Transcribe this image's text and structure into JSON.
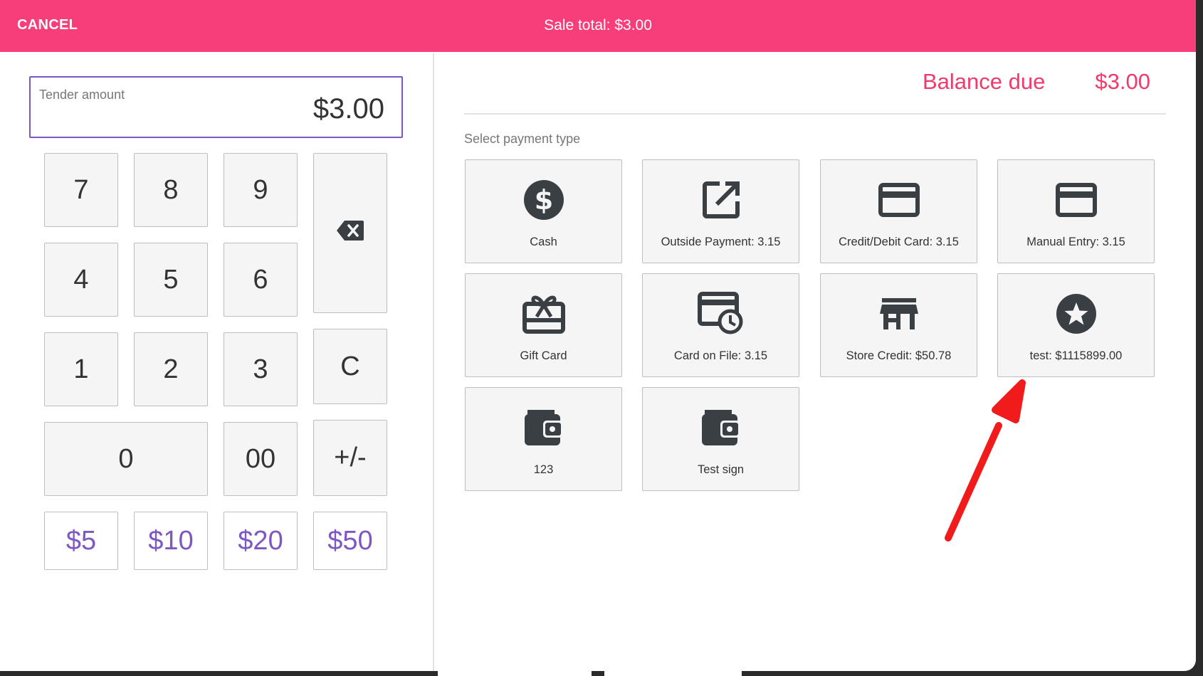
{
  "header": {
    "cancel_label": "CANCEL",
    "sale_total": "Sale total: $3.00",
    "bar_color": "#f73e7b"
  },
  "tender": {
    "label": "Tender amount",
    "value": "$3.00"
  },
  "keypad": {
    "digits": [
      "7",
      "8",
      "9",
      "4",
      "5",
      "6",
      "1",
      "2",
      "3"
    ],
    "zero": "0",
    "double_zero": "00",
    "clear": "C",
    "sign": "+/-",
    "backspace_icon": "backspace-icon",
    "quick_amounts": [
      "$5",
      "$10",
      "$20",
      "$50"
    ],
    "accent_color": "#7e57c2"
  },
  "balance": {
    "label": "Balance due",
    "value": "$3.00",
    "color": "#f03a6c"
  },
  "payment": {
    "section_label": "Select payment type",
    "types": [
      {
        "label": "Cash",
        "icon": "dollar-circle-icon"
      },
      {
        "label": "Outside Payment: 3.15",
        "icon": "external-link-icon"
      },
      {
        "label": "Credit/Debit Card: 3.15",
        "icon": "credit-card-icon"
      },
      {
        "label": "Manual Entry: 3.15",
        "icon": "credit-card-icon"
      },
      {
        "label": "Gift Card",
        "icon": "gift-card-icon"
      },
      {
        "label": "Card on File: 3.15",
        "icon": "card-clock-icon"
      },
      {
        "label": "Store Credit: $50.78",
        "icon": "store-icon"
      },
      {
        "label": "test: $1115899.00",
        "icon": "star-circle-icon"
      },
      {
        "label": "123",
        "icon": "wallet-icon"
      },
      {
        "label": "Test sign",
        "icon": "wallet-icon"
      }
    ]
  },
  "annotation": {
    "arrow_color": "#f21b1b"
  }
}
